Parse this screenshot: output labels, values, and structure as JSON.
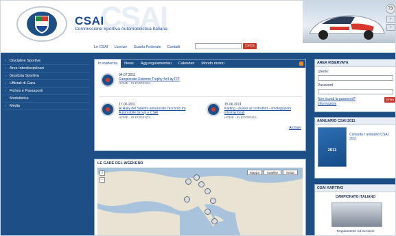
{
  "header": {
    "brand": "CSAI",
    "brand_subtitle": "Commissione Sportiva Automobilistica Italiana",
    "logo_icon": "csai-shield-logo",
    "banner_number": "73"
  },
  "topnav": {
    "links": [
      "Le CSAI",
      "Licenze",
      "Scuola Federale",
      "Contatti"
    ],
    "search_value": "",
    "search_button": "Cerca"
  },
  "sidebar": {
    "items": [
      "Discipline Sportive",
      "Aree Interdisciplinari",
      "Giustizia Sportiva",
      "Ufficiali di Gara",
      "Fiches e Passaporti",
      "Modulistica",
      "Media"
    ]
  },
  "evidenza": {
    "tabs": [
      "In evidenza",
      "News",
      "Agg.regolamentari",
      "Calendari",
      "Mondo motori"
    ],
    "news": [
      {
        "date": "04.07.2011",
        "title": "Campionato Extreme Trophy 4x4 by FIF",
        "category": "HOME - IN EVIDENZA"
      },
      {
        "date": "17.06.2011",
        "title": "Al Rally del Salento annunciato l'accordo tra Automobile Group e CSAI",
        "category": "HOME - IN EVIDENZA"
      },
      {
        "date": "15.06.2011",
        "title": "Karting - avviso ai costruttori - omologazioni internazionali",
        "category": "HOME - IN EVIDENZA"
      }
    ],
    "archive_link": "Archivio"
  },
  "map_panel": {
    "title": "LE GARE DEL WEEKEND",
    "controls": [
      "Mappa",
      "Satellite",
      "Ibrida"
    ]
  },
  "area_riservata": {
    "title": "AREA RISERVATA",
    "user_label": "Utente:",
    "password_label": "Password",
    "forgot_link": "Non ricordi la password?",
    "info_link": "Informazioni",
    "login_button": "Entra"
  },
  "annuario": {
    "title": "ANNUARIO CSAI 2011",
    "link": "Consulta l' annuario CSAI 2011",
    "cover_text": "2011"
  },
  "karting": {
    "title": "CSAI KARTING",
    "heading": "CAMPIONATO ITALIANO",
    "footer": "Regolamento ed iscrizioni"
  },
  "colors": {
    "brand_blue": "#1a4a9a",
    "body_blue": "#1d4f86",
    "accent_red": "#c53a2a",
    "rss_orange": "#f08a24"
  }
}
